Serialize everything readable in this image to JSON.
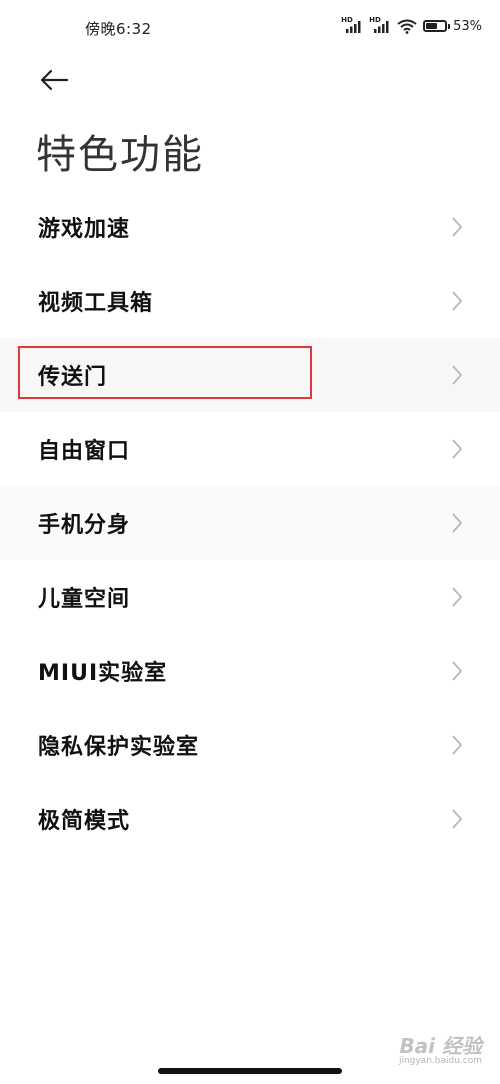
{
  "status_bar": {
    "time": "傍晚6:32",
    "signal1_label": "HD",
    "signal2_label": "HD",
    "battery_percent": "53%"
  },
  "header": {
    "title": "特色功能"
  },
  "menu": {
    "items": [
      {
        "label": "游戏加速"
      },
      {
        "label": "视频工具箱"
      },
      {
        "label": "传送门"
      },
      {
        "label": "自由窗口"
      },
      {
        "label": "手机分身"
      },
      {
        "label": "儿童空间"
      },
      {
        "label": "MIUI实验室"
      },
      {
        "label": "隐私保护实验室"
      },
      {
        "label": "极简模式"
      }
    ]
  },
  "watermark": {
    "brand": "Bai 经验",
    "url": "jingyan.baidu.com"
  },
  "colors": {
    "highlight_border": "#e0383b",
    "text": "#111111",
    "chevron": "#b8b8b8"
  }
}
